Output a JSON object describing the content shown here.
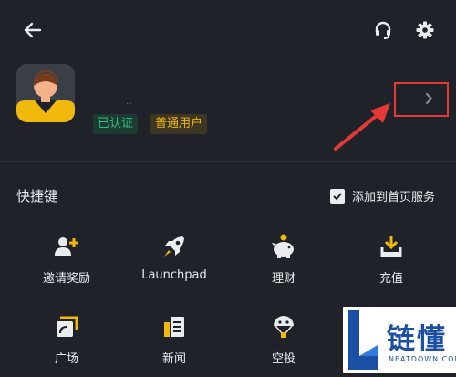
{
  "header": {
    "back_icon": "arrow-left-icon",
    "support_icon": "headset-icon",
    "settings_icon": "gear-icon"
  },
  "profile": {
    "name": "..",
    "badge_verified": "已认证",
    "badge_user_type": "普通用户",
    "verified_color": "#2ebd85",
    "user_type_color": "#f0b90b"
  },
  "shortcuts": {
    "title": "快捷键",
    "add_to_home_label": "添加到首页服务",
    "items": [
      {
        "label": "邀请奖励",
        "icon": "invite-reward-icon"
      },
      {
        "label": "Launchpad",
        "icon": "rocket-icon"
      },
      {
        "label": "理财",
        "icon": "piggy-bank-icon"
      },
      {
        "label": "充值",
        "icon": "deposit-icon"
      },
      {
        "label": "广场",
        "icon": "square-feed-icon"
      },
      {
        "label": "新闻",
        "icon": "news-icon"
      },
      {
        "label": "空投",
        "icon": "airdrop-icon"
      }
    ]
  },
  "watermark": {
    "text": "链懂",
    "subtext": "NEATDOWN.COM"
  },
  "colors": {
    "background": "#1f2329",
    "accent": "#f0b90b",
    "annotation": "#e53935"
  }
}
